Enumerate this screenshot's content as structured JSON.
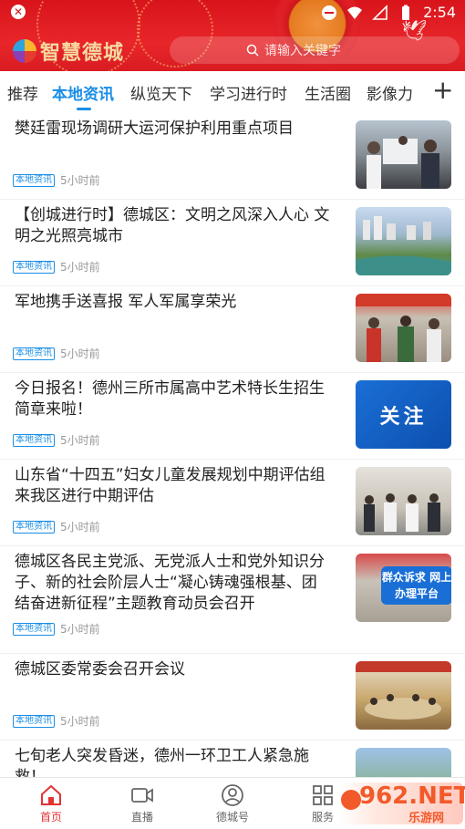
{
  "status": {
    "time": "2:54"
  },
  "header": {
    "app_name": "智慧德城",
    "search_placeholder": "请输入关键字"
  },
  "tabs": [
    {
      "label": "推荐"
    },
    {
      "label": "本地资讯"
    },
    {
      "label": "纵览天下"
    },
    {
      "label": "学习进行时"
    },
    {
      "label": "生活圈"
    },
    {
      "label": "影像力"
    }
  ],
  "active_tab": "本地资讯",
  "feed": [
    {
      "title": "樊廷雷现场调研大运河保护利用重点项目",
      "badge": "本地资讯",
      "time": "5小时前"
    },
    {
      "title": "【创城进行时】德城区：文明之风深入人心 文明之光照亮城市",
      "badge": "本地资讯",
      "time": "5小时前"
    },
    {
      "title": "军地携手送喜报  军人军属享荣光",
      "badge": "本地资讯",
      "time": "5小时前"
    },
    {
      "title": "今日报名！德州三所市属高中艺术特长生招生简章来啦！",
      "badge": "本地资讯",
      "time": "5小时前",
      "thumb_text": "关注"
    },
    {
      "title": "山东省“十四五”妇女儿童发展规划中期评估组来我区进行中期评估",
      "badge": "本地资讯",
      "time": "5小时前"
    },
    {
      "title": "德城区各民主党派、无党派人士和党外知识分子、新的社会阶层人士“凝心铸魂强根基、团结奋进新征程”主题教育动员会召开",
      "badge": "本地资讯",
      "time": "5小时前",
      "thumb_text": "群众诉求 网上办理平台"
    },
    {
      "title": "德城区委常委会召开会议",
      "badge": "本地资讯",
      "time": "5小时前"
    },
    {
      "title": "七旬老人突发昏迷，德州一环卫工人紧急施救！",
      "badge": "",
      "time": ""
    }
  ],
  "nav": [
    {
      "label": "首页"
    },
    {
      "label": "直播"
    },
    {
      "label": "德城号"
    },
    {
      "label": "服务"
    }
  ],
  "watermark": {
    "big": "962.NET",
    "small": "乐游网"
  },
  "colors": {
    "header_red": "#d8141a",
    "accent_blue": "#1a8ee6",
    "nav_active": "#e23434"
  }
}
